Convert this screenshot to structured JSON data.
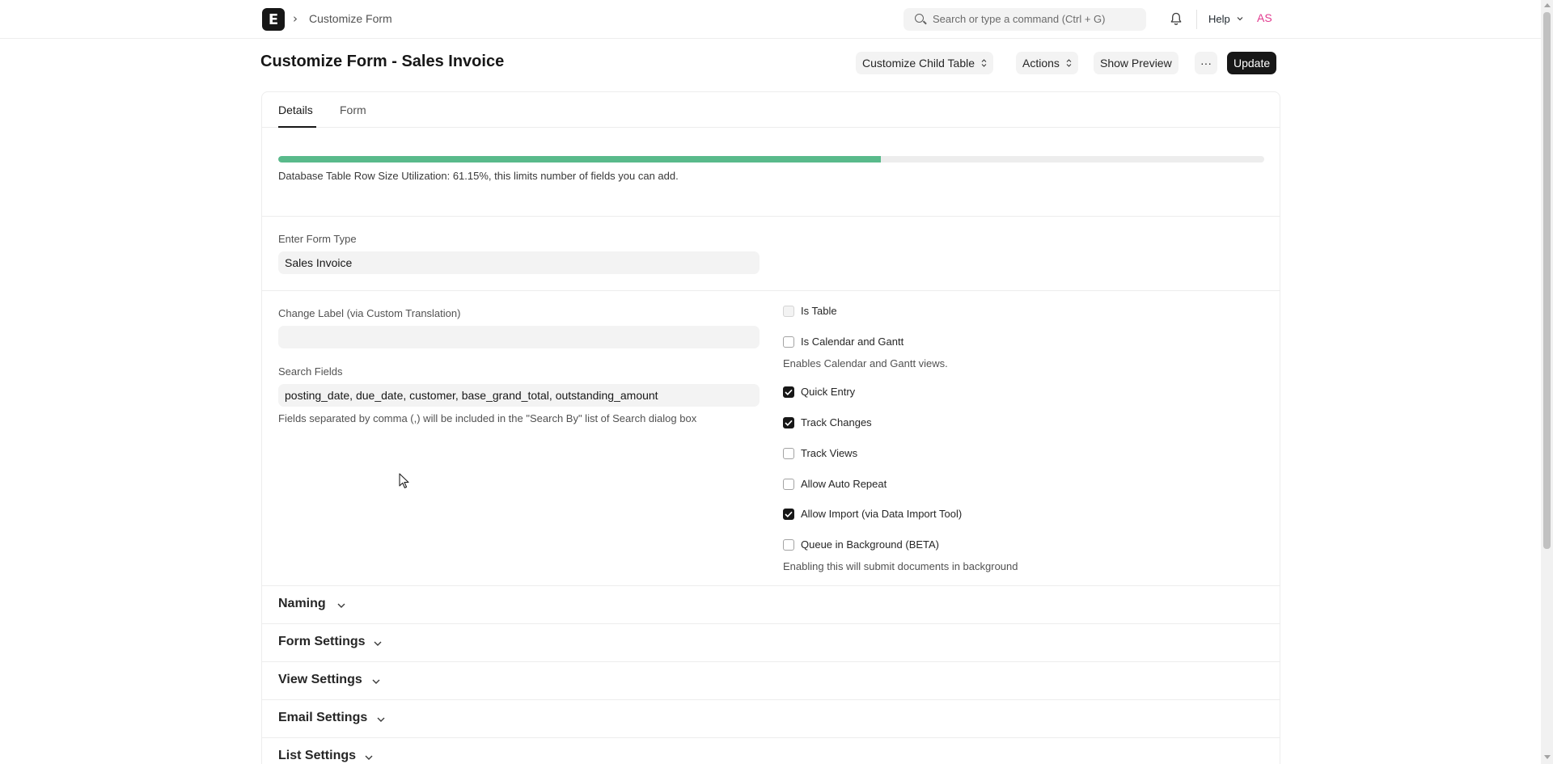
{
  "navbar": {
    "logo_letter": "E",
    "breadcrumb": "Customize Form",
    "search_placeholder": "Search or type a command (Ctrl + G)",
    "help_label": "Help",
    "avatar_initials": "AS",
    "avatar_color": "#e23a8f"
  },
  "page": {
    "title": "Customize Form - Sales Invoice",
    "buttons": {
      "customize_child_table": "Customize Child Table",
      "actions": "Actions",
      "show_preview": "Show Preview",
      "more": "···",
      "update": "Update"
    }
  },
  "tabs": [
    {
      "label": "Details",
      "active": true
    },
    {
      "label": "Form",
      "active": false
    }
  ],
  "utilization": {
    "percent": 61.15,
    "text": "Database Table Row Size Utilization: 61.15%, this limits number of fields you can add.",
    "bar_color": "#59ba8b"
  },
  "form_type": {
    "label": "Enter Form Type",
    "value": "Sales Invoice"
  },
  "change_label": {
    "label": "Change Label (via Custom Translation)",
    "value": ""
  },
  "search_fields": {
    "label": "Search Fields",
    "value": "posting_date, due_date, customer, base_grand_total, outstanding_amount",
    "help": "Fields separated by comma (,) will be included in the \"Search By\" list of Search dialog box"
  },
  "checkboxes": [
    {
      "label": "Is Table",
      "checked": false,
      "disabled": true
    },
    {
      "label": "Is Calendar and Gantt",
      "checked": false,
      "disabled": false
    },
    {
      "label": "Quick Entry",
      "checked": true,
      "disabled": false
    },
    {
      "label": "Track Changes",
      "checked": true,
      "disabled": false
    },
    {
      "label": "Track Views",
      "checked": false,
      "disabled": false
    },
    {
      "label": "Allow Auto Repeat",
      "checked": false,
      "disabled": false
    },
    {
      "label": "Allow Import (via Data Import Tool)",
      "checked": true,
      "disabled": false
    },
    {
      "label": "Queue in Background (BETA)",
      "checked": false,
      "disabled": false
    }
  ],
  "checkbox_help": {
    "calendar": "Enables Calendar and Gantt views.",
    "queue": "Enabling this will submit documents in background"
  },
  "sections": [
    {
      "label": "Naming"
    },
    {
      "label": "Form Settings"
    },
    {
      "label": "View Settings"
    },
    {
      "label": "Email Settings"
    },
    {
      "label": "List Settings"
    }
  ]
}
